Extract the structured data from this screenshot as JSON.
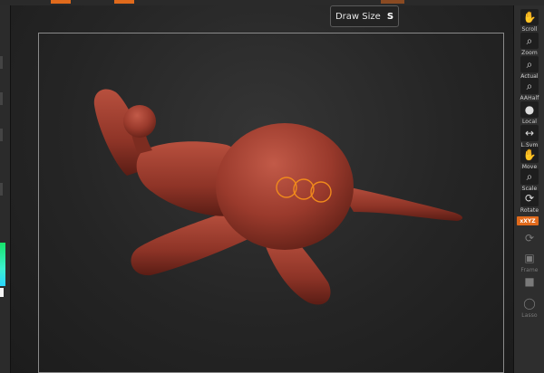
{
  "tooltip": {
    "label": "Draw Size",
    "hotkey": "S"
  },
  "colors": {
    "accent": "#e06a1c",
    "clay": "#9a3a2c",
    "brush_ring": "#f08a1c",
    "frame": "#8a8a8a"
  },
  "shelf": {
    "buttons": [
      {
        "label": "Scroll",
        "icon": "scroll-icon"
      },
      {
        "label": "Zoom",
        "icon": "zoom-icon"
      },
      {
        "label": "Actual",
        "icon": "actual-icon"
      },
      {
        "label": "AAHalf",
        "icon": "aahalf-icon"
      },
      {
        "label": "Local",
        "icon": "local-icon"
      },
      {
        "label": "L.Sym",
        "icon": "lsym-icon"
      },
      {
        "label": "Move",
        "icon": "move-icon"
      },
      {
        "label": "Scale",
        "icon": "scale-icon"
      },
      {
        "label": "Rotate",
        "icon": "rotate-icon"
      }
    ],
    "xyz_label": "xXYZ",
    "lower_buttons": [
      {
        "label": "",
        "icon": "rotate-arrow-icon"
      },
      {
        "label": "Frame",
        "icon": "frame-icon"
      },
      {
        "label": "",
        "icon": "move-gizmo-icon"
      },
      {
        "label": "Lasso",
        "icon": "lasso-icon"
      }
    ]
  }
}
